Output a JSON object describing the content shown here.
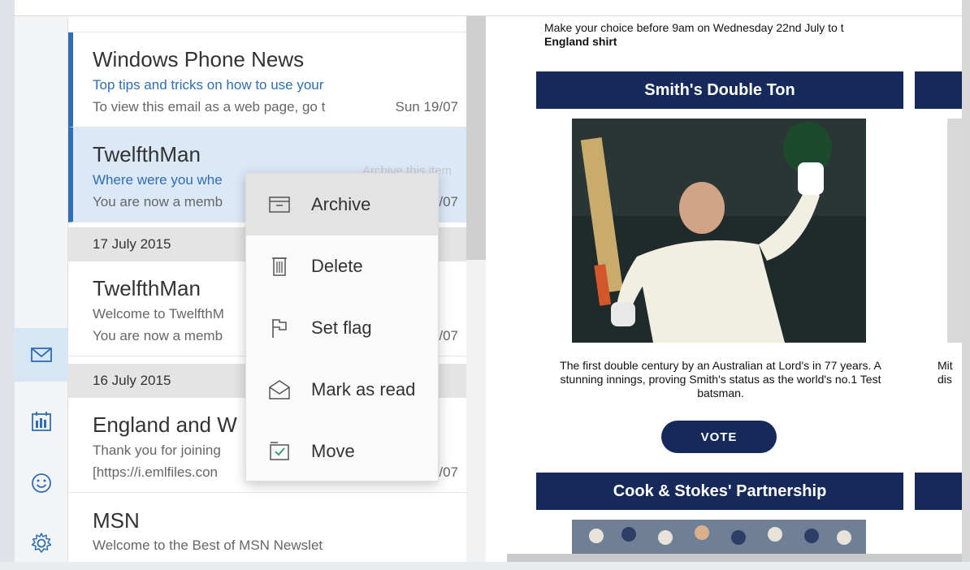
{
  "rail": {
    "items": [
      {
        "icon": "mail-icon",
        "active": true
      },
      {
        "icon": "calendar-icon",
        "active": false
      },
      {
        "icon": "smiley-icon",
        "active": false
      },
      {
        "icon": "gear-icon",
        "active": false
      }
    ]
  },
  "list": {
    "messages": [
      {
        "sender": "Windows Phone News",
        "subject": "Top tips and tricks on how to use your",
        "preview": "To view this email as a web page, go t",
        "date": "Sun 19/07"
      },
      {
        "sender": "TwelfthMan",
        "subject": "Where were you whe",
        "preview": "You are now a memb",
        "date": "/07"
      },
      {
        "sender": "TwelfthMan",
        "subject": "Welcome to TwelfthM",
        "preview": "You are now a memb",
        "date": "/07"
      },
      {
        "sender": "England and W",
        "subject": "Thank you for joining",
        "preview": "[https://i.emlfiles.con",
        "date": "/07"
      },
      {
        "sender": "MSN",
        "subject": "Welcome to the Best of MSN Newslet",
        "preview": "",
        "date": ""
      }
    ],
    "sections": [
      "17 July 2015",
      "16 July 2015"
    ],
    "tooltip": "Archive this item"
  },
  "context_menu": {
    "items": [
      {
        "label": "Archive",
        "icon": "archive-icon"
      },
      {
        "label": "Delete",
        "icon": "trash-icon"
      },
      {
        "label": "Set flag",
        "icon": "flag-icon"
      },
      {
        "label": "Mark as read",
        "icon": "envelope-open-icon"
      },
      {
        "label": "Move",
        "icon": "folder-move-icon"
      }
    ]
  },
  "reading": {
    "intro_line": "Make your choice before 9am on Wednesday 22nd July to t",
    "intro_bold": "England shirt",
    "card1_title": "Smith's Double Ton",
    "card1_caption": "The first double century by an Australian at Lord's in 77 years. A stunning innings, proving Smith's status as the world's no.1 Test batsman.",
    "vote_label": "VOTE",
    "card2_title": "Cook & Stokes' Partnership",
    "cut_caption_1": "Mit",
    "cut_caption_2": "dis"
  },
  "colors": {
    "accent": "#2f6db4",
    "banner": "#15295a"
  }
}
